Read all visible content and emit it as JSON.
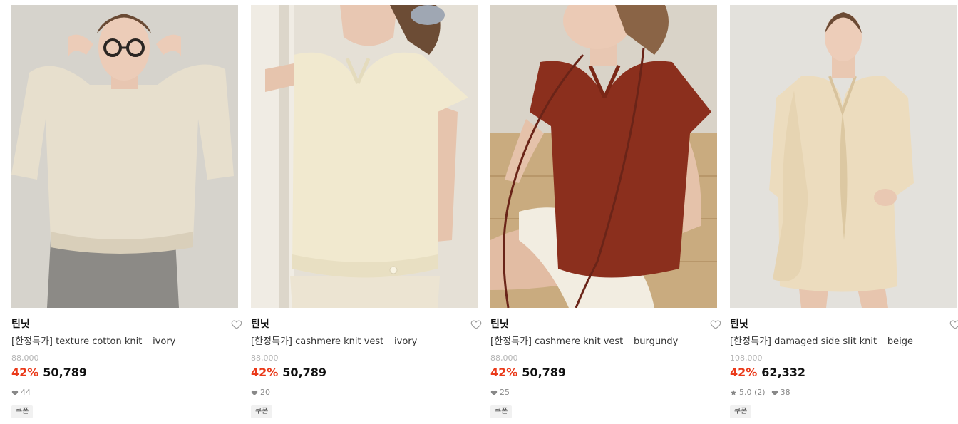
{
  "products": [
    {
      "brand": "틴닛",
      "title": "[한정특가] texture cotton knit _ ivory",
      "original_price": "88,000",
      "discount": "42%",
      "price": "50,789",
      "likes": "44",
      "rating": null,
      "badge": "쿠폰"
    },
    {
      "brand": "틴닛",
      "title": "[한정특가] cashmere knit vest _ ivory",
      "original_price": "88,000",
      "discount": "42%",
      "price": "50,789",
      "likes": "20",
      "rating": null,
      "badge": "쿠폰"
    },
    {
      "brand": "틴닛",
      "title": "[한정특가] cashmere knit vest _ burgundy",
      "original_price": "88,000",
      "discount": "42%",
      "price": "50,789",
      "likes": "25",
      "rating": null,
      "badge": "쿠폰"
    },
    {
      "brand": "틴닛",
      "title": "[한정특가] damaged side slit knit _ beige",
      "original_price": "108,000",
      "discount": "42%",
      "price": "62,332",
      "likes": "38",
      "rating": "5.0 (2)",
      "badge": "쿠폰"
    }
  ],
  "colors": {
    "discount": "#ea3a1a",
    "meta": "#888888",
    "strike": "#b5b5b5",
    "coupon_bg": "#f1f1f1"
  },
  "icons": {
    "wishlist": "heart-outline-icon",
    "likes": "heart-filled-icon",
    "rating": "star-icon"
  }
}
